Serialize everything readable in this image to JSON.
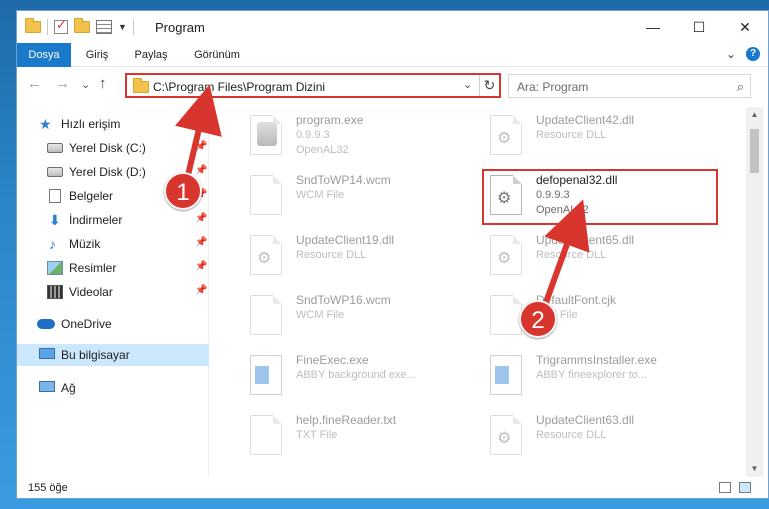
{
  "window": {
    "title": "Program",
    "controls": {
      "minimize": "—",
      "maximize": "☐",
      "close": "✕"
    }
  },
  "ribbon": {
    "tabs": [
      "Dosya",
      "Giriş",
      "Paylaş",
      "Görünüm"
    ],
    "help": "?",
    "collapse": "⌄"
  },
  "address": {
    "back": "←",
    "forward": "→",
    "recent": "⌄",
    "up": "↑",
    "path": "C:\\Program Files\\Program Dizini",
    "dropdown": "⌄",
    "refresh": "↻"
  },
  "search": {
    "placeholder": "Ara: Program",
    "icon": "⌕"
  },
  "sidebar": {
    "items": [
      {
        "label": "Hızlı erişim",
        "icon": "star-icon",
        "glyph": "★",
        "pinned": false
      },
      {
        "label": "Yerel Disk (C:)",
        "icon": "drive-icon",
        "glyph": "",
        "pinned": true
      },
      {
        "label": "Yerel Disk (D:)",
        "icon": "drive-icon",
        "glyph": "",
        "pinned": true
      },
      {
        "label": "Belgeler",
        "icon": "document-icon",
        "glyph": "",
        "pinned": true
      },
      {
        "label": "İndirmeler",
        "icon": "download-icon",
        "glyph": "⬇",
        "pinned": true
      },
      {
        "label": "Müzik",
        "icon": "music-icon",
        "glyph": "♪",
        "pinned": true
      },
      {
        "label": "Resimler",
        "icon": "pictures-icon",
        "glyph": "",
        "pinned": true
      },
      {
        "label": "Videolar",
        "icon": "videos-icon",
        "glyph": "",
        "pinned": true
      },
      {
        "label": "OneDrive",
        "icon": "cloud-icon",
        "glyph": "",
        "pinned": false
      },
      {
        "label": "Bu bilgisayar",
        "icon": "computer-icon",
        "glyph": "",
        "pinned": false,
        "selected": true
      },
      {
        "label": "Ağ",
        "icon": "network-icon",
        "glyph": "",
        "pinned": false
      }
    ],
    "pin_glyph": "📌"
  },
  "files": [
    {
      "name": "program.exe",
      "line2": "0.9.9.3",
      "line3": "OpenAL32",
      "icon": "program-icon",
      "faded": true
    },
    {
      "name": "UpdateClient42.dll",
      "line2": "Resource DLL",
      "line3": "",
      "icon": "dll-icon",
      "faded": true
    },
    {
      "name": "SndToWP14.wcm",
      "line2": "WCM File",
      "line3": "",
      "icon": "file-icon",
      "faded": true
    },
    {
      "name": "defopenal32.dll",
      "line2": "0.9.9.3",
      "line3": "OpenAL32",
      "icon": "dll-icon",
      "faded": false
    },
    {
      "name": "UpdateClient19.dll",
      "line2": "Resource DLL",
      "line3": "",
      "icon": "dll-icon",
      "faded": true
    },
    {
      "name": "UpdateClient65.dll",
      "line2": "Resource DLL",
      "line3": "",
      "icon": "dll-icon",
      "faded": true
    },
    {
      "name": "SndToWP16.wcm",
      "line2": "WCM File",
      "line3": "",
      "icon": "file-icon",
      "faded": true
    },
    {
      "name": "DefaultFont.cjk",
      "line2": "CJK File",
      "line3": "",
      "icon": "file-icon",
      "faded": true
    },
    {
      "name": "FineExec.exe",
      "line2": "ABBY background exe...",
      "line3": "",
      "icon": "exe-icon",
      "faded": true
    },
    {
      "name": "TrigrammsInstaller.exe",
      "line2": "ABBY fineexplorer to...",
      "line3": "",
      "icon": "exe-icon",
      "faded": true
    },
    {
      "name": "help.fineReader.txt",
      "line2": "TXT File",
      "line3": "",
      "icon": "file-icon",
      "faded": true
    },
    {
      "name": "UpdateClient63.dll",
      "line2": "Resource DLL",
      "line3": "",
      "icon": "dll-icon",
      "faded": true
    }
  ],
  "scrollbar": {
    "up": "▲",
    "down": "▼"
  },
  "status": {
    "count": "155 öğe"
  },
  "annotations": {
    "badge1": "1",
    "badge2": "2",
    "color": "#d9352f"
  }
}
